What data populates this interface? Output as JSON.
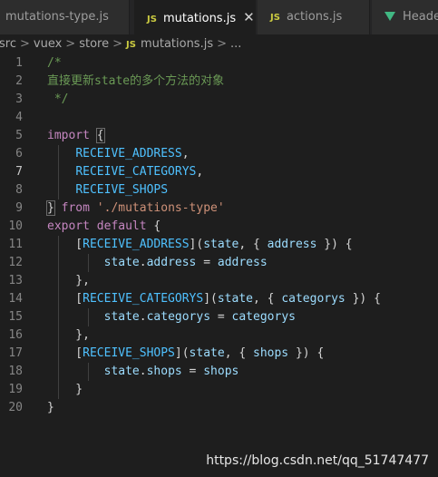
{
  "tabs": [
    {
      "label": "mutations-type.js",
      "icon": "js-icon",
      "active": false
    },
    {
      "label": "mutations.js",
      "icon": "js-icon",
      "active": true
    },
    {
      "label": "actions.js",
      "icon": "js-icon",
      "active": false
    },
    {
      "label": "Header",
      "icon": "vue-icon",
      "active": false
    }
  ],
  "tab_icon_text": "JS",
  "close_glyph": "✕",
  "breadcrumb": {
    "items": [
      "src",
      "vuex",
      "store",
      "mutations.js",
      "..."
    ],
    "separator": ">"
  },
  "editor": {
    "line_numbers": [
      "1",
      "2",
      "3",
      "4",
      "5",
      "6",
      "7",
      "8",
      "9",
      "10",
      "11",
      "12",
      "13",
      "14",
      "15",
      "16",
      "17",
      "18",
      "19",
      "20"
    ],
    "current_line": 7,
    "lines": [
      [
        {
          "t": "comment",
          "v": "/*"
        }
      ],
      [
        {
          "t": "comment",
          "v": "直接更新state的多个方法的对象"
        }
      ],
      [
        {
          "t": "comment",
          "v": " */"
        }
      ],
      [],
      [
        {
          "t": "keyword",
          "v": "import"
        },
        {
          "t": "punct",
          "v": " "
        },
        {
          "t": "bracket",
          "v": "{"
        }
      ],
      [
        {
          "t": "punct",
          "v": "    "
        },
        {
          "t": "const",
          "v": "RECEIVE_ADDRESS"
        },
        {
          "t": "punct",
          "v": ","
        }
      ],
      [
        {
          "t": "punct",
          "v": "    "
        },
        {
          "t": "const",
          "v": "RECEIVE_CATEGORYS"
        },
        {
          "t": "punct",
          "v": ","
        }
      ],
      [
        {
          "t": "punct",
          "v": "    "
        },
        {
          "t": "const",
          "v": "RECEIVE_SHOPS"
        }
      ],
      [
        {
          "t": "bracket",
          "v": "}"
        },
        {
          "t": "punct",
          "v": " "
        },
        {
          "t": "keyword",
          "v": "from"
        },
        {
          "t": "punct",
          "v": " "
        },
        {
          "t": "string",
          "v": "'./mutations-type'"
        }
      ],
      [
        {
          "t": "keyword",
          "v": "export"
        },
        {
          "t": "punct",
          "v": " "
        },
        {
          "t": "keyword",
          "v": "default"
        },
        {
          "t": "punct",
          "v": " {"
        }
      ],
      [
        {
          "t": "punct",
          "v": "    ["
        },
        {
          "t": "const",
          "v": "RECEIVE_ADDRESS"
        },
        {
          "t": "punct",
          "v": "]("
        },
        {
          "t": "var",
          "v": "state"
        },
        {
          "t": "punct",
          "v": ", { "
        },
        {
          "t": "var",
          "v": "address"
        },
        {
          "t": "punct",
          "v": " }) {"
        }
      ],
      [
        {
          "t": "punct",
          "v": "        "
        },
        {
          "t": "var",
          "v": "state"
        },
        {
          "t": "punct",
          "v": "."
        },
        {
          "t": "var",
          "v": "address"
        },
        {
          "t": "punct",
          "v": " = "
        },
        {
          "t": "var",
          "v": "address"
        }
      ],
      [
        {
          "t": "punct",
          "v": "    },"
        }
      ],
      [
        {
          "t": "punct",
          "v": "    ["
        },
        {
          "t": "const",
          "v": "RECEIVE_CATEGORYS"
        },
        {
          "t": "punct",
          "v": "]("
        },
        {
          "t": "var",
          "v": "state"
        },
        {
          "t": "punct",
          "v": ", { "
        },
        {
          "t": "var",
          "v": "categorys"
        },
        {
          "t": "punct",
          "v": " }) {"
        }
      ],
      [
        {
          "t": "punct",
          "v": "        "
        },
        {
          "t": "var",
          "v": "state"
        },
        {
          "t": "punct",
          "v": "."
        },
        {
          "t": "var",
          "v": "categorys"
        },
        {
          "t": "punct",
          "v": " = "
        },
        {
          "t": "var",
          "v": "categorys"
        }
      ],
      [
        {
          "t": "punct",
          "v": "    },"
        }
      ],
      [
        {
          "t": "punct",
          "v": "    ["
        },
        {
          "t": "const",
          "v": "RECEIVE_SHOPS"
        },
        {
          "t": "punct",
          "v": "]("
        },
        {
          "t": "var",
          "v": "state"
        },
        {
          "t": "punct",
          "v": ", { "
        },
        {
          "t": "var",
          "v": "shops"
        },
        {
          "t": "punct",
          "v": " }) {"
        }
      ],
      [
        {
          "t": "punct",
          "v": "        "
        },
        {
          "t": "var",
          "v": "state"
        },
        {
          "t": "punct",
          "v": "."
        },
        {
          "t": "var",
          "v": "shops"
        },
        {
          "t": "punct",
          "v": " = "
        },
        {
          "t": "var",
          "v": "shops"
        }
      ],
      [
        {
          "t": "punct",
          "v": "    }"
        }
      ],
      [
        {
          "t": "punct",
          "v": "}"
        }
      ]
    ]
  },
  "watermark": "https://blog.csdn.net/qq_51747477"
}
